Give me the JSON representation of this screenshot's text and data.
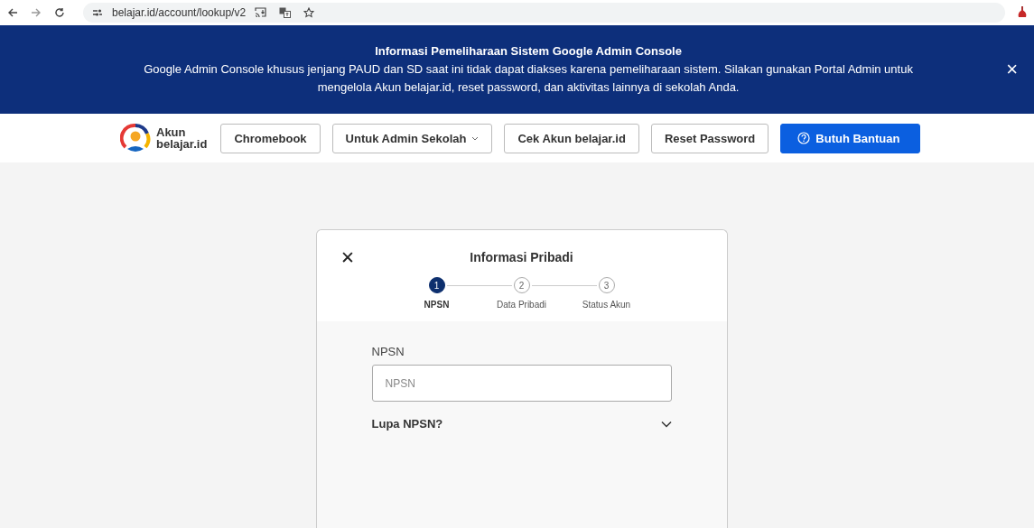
{
  "browser": {
    "url": "belajar.id/account/lookup/v2"
  },
  "banner": {
    "title": "Informasi Pemeliharaan Sistem Google Admin Console",
    "message": "Google Admin Console khusus jenjang PAUD dan SD saat ini tidak dapat diakses karena pemeliharaan sistem. Silakan gunakan Portal Admin untuk mengelola Akun belajar.id, reset password, dan aktivitas lainnya di sekolah Anda.",
    "close": "×"
  },
  "nav": {
    "brand": [
      "Akun",
      "belajar.id"
    ],
    "buttons": [
      {
        "label": "Chromebook",
        "kind": "plain"
      },
      {
        "label": "Untuk Admin Sekolah",
        "kind": "dropdown"
      },
      {
        "label": "Cek Akun belajar.id",
        "kind": "plain"
      },
      {
        "label": "Reset Password",
        "kind": "plain"
      },
      {
        "label": "Butuh Bantuan",
        "kind": "primary"
      }
    ]
  },
  "modal": {
    "title": "Informasi Pribadi",
    "close": "✕",
    "steps": [
      {
        "number": "1",
        "label": "NPSN",
        "selected": true
      },
      {
        "number": "2",
        "label": "Data Pribadi",
        "selected": false
      },
      {
        "number": "3",
        "label": "Status Akun",
        "selected": false
      }
    ],
    "field": {
      "label": "NPSN",
      "placeholder": "NPSN"
    },
    "accordion": {
      "label": "Lupa NPSN?",
      "expanded": false
    }
  }
}
